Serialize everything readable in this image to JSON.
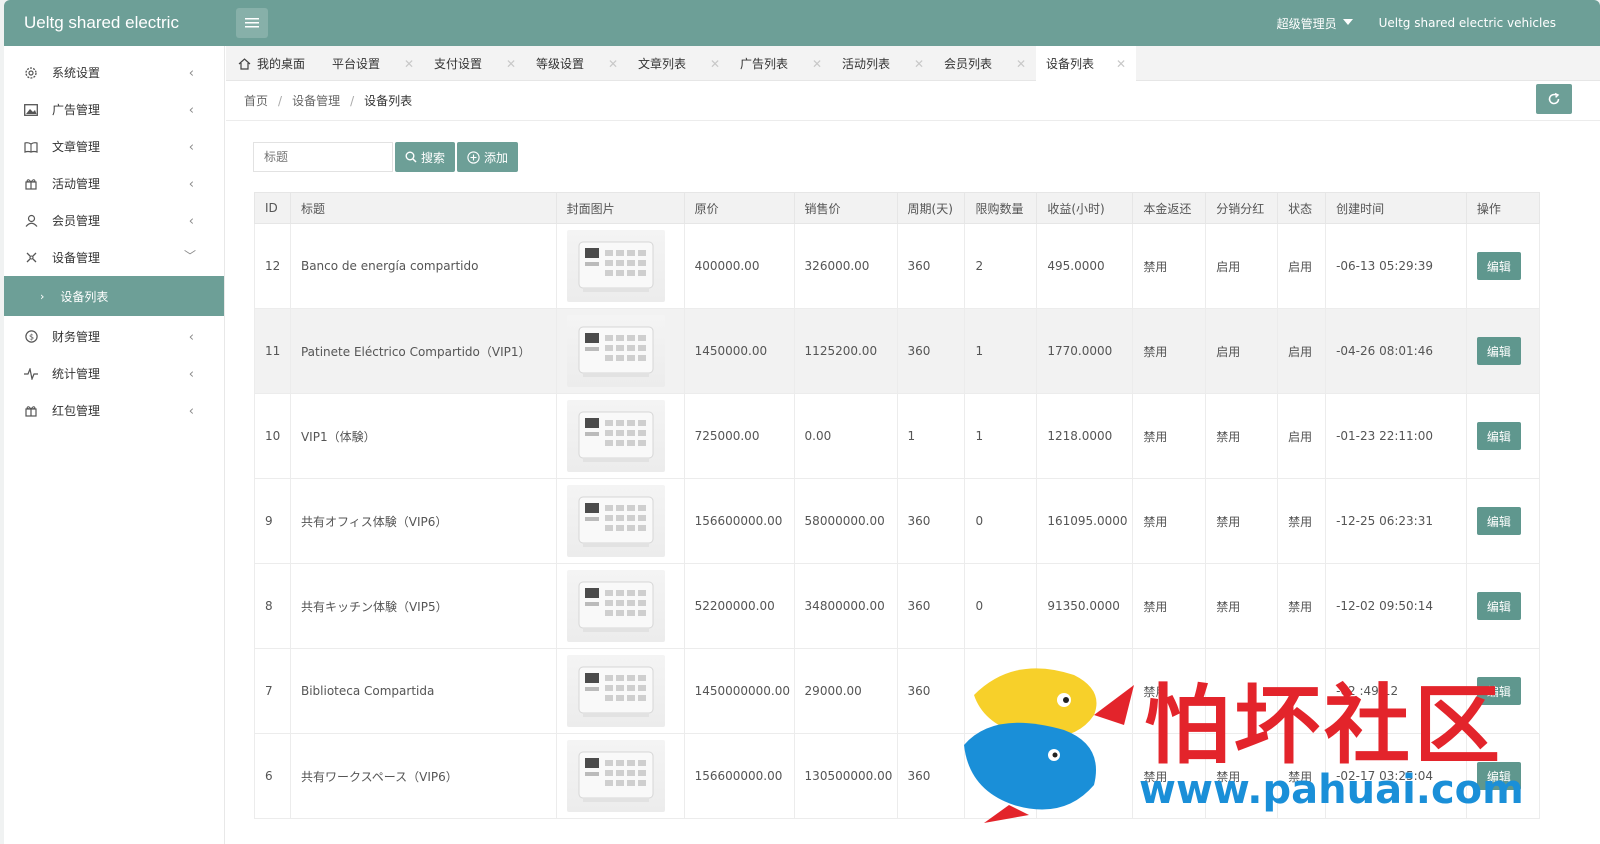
{
  "header": {
    "logo": "Ueltg shared electric",
    "user": "超级管理员",
    "site": "Ueltg shared electric vehicles"
  },
  "sidebar": {
    "items": [
      {
        "label": "系统设置",
        "icon": "gear-icon"
      },
      {
        "label": "广告管理",
        "icon": "image-icon"
      },
      {
        "label": "文章管理",
        "icon": "book-icon"
      },
      {
        "label": "活动管理",
        "icon": "gift-icon"
      },
      {
        "label": "会员管理",
        "icon": "user-icon"
      },
      {
        "label": "设备管理",
        "icon": "device-icon",
        "expanded": true
      }
    ],
    "sub_item": "设备列表",
    "items_after": [
      {
        "label": "财务管理",
        "icon": "dollar-icon"
      },
      {
        "label": "统计管理",
        "icon": "pulse-icon"
      },
      {
        "label": "红包管理",
        "icon": "gift-icon"
      }
    ]
  },
  "tabs": [
    "我的桌面",
    "平台设置",
    "支付设置",
    "等级设置",
    "文章列表",
    "广告列表",
    "活动列表",
    "会员列表",
    "设备列表"
  ],
  "breadcrumb": [
    "首页",
    "设备管理",
    "设备列表"
  ],
  "toolbar": {
    "search_placeholder": "标题",
    "search_label": "搜索",
    "add_label": "添加"
  },
  "table": {
    "headers": [
      "ID",
      "标题",
      "封面图片",
      "原价",
      "销售价",
      "周期(天)",
      "限购数量",
      "收益(小时)",
      "本金返还",
      "分销分红",
      "状态",
      "创建时间",
      "操作"
    ],
    "edit_label": "编辑",
    "rows": [
      {
        "id": "12",
        "title": "Banco de energía compartido",
        "orig": "400000.00",
        "sale": "326000.00",
        "period": "360",
        "limit": "2",
        "income": "495.0000",
        "refund": "禁用",
        "dist": "启用",
        "status": "启用",
        "created": "-06-13 05:29:39"
      },
      {
        "id": "11",
        "title": "Patinete Eléctrico Compartido（VIP1）",
        "orig": "1450000.00",
        "sale": "1125200.00",
        "period": "360",
        "limit": "1",
        "income": "1770.0000",
        "refund": "禁用",
        "dist": "启用",
        "status": "启用",
        "created": "-04-26 08:01:46"
      },
      {
        "id": "10",
        "title": "VIP1（体験）",
        "orig": "725000.00",
        "sale": "0.00",
        "period": "1",
        "limit": "1",
        "income": "1218.0000",
        "refund": "禁用",
        "dist": "禁用",
        "status": "启用",
        "created": "-01-23 22:11:00"
      },
      {
        "id": "9",
        "title": "共有オフィス体験（VIP6）",
        "orig": "156600000.00",
        "sale": "58000000.00",
        "period": "360",
        "limit": "0",
        "income": "161095.0000",
        "refund": "禁用",
        "dist": "禁用",
        "status": "禁用",
        "created": "-12-25 06:23:31"
      },
      {
        "id": "8",
        "title": "共有キッチン体験（VIP5）",
        "orig": "52200000.00",
        "sale": "34800000.00",
        "period": "360",
        "limit": "0",
        "income": "91350.0000",
        "refund": "禁用",
        "dist": "禁用",
        "status": "禁用",
        "created": "-12-02 09:50:14"
      },
      {
        "id": "7",
        "title": "Biblioteca Compartida",
        "orig": "1450000000.00",
        "sale": "29000.00",
        "period": "360",
        "limit": "",
        "income": "",
        "refund": "禁用",
        "dist": "",
        "status": "",
        "created": "-02 :49:12"
      },
      {
        "id": "6",
        "title": "共有ワークスペース（VIP6）",
        "orig": "156600000.00",
        "sale": "130500000.00",
        "period": "360",
        "limit": "",
        "income": "",
        "refund": "禁用",
        "dist": "禁用",
        "status": "禁用",
        "created": "-02-17 03:25:04"
      }
    ]
  },
  "watermark": {
    "text": "怕坏社区",
    "url": "www.pahuai.com"
  }
}
